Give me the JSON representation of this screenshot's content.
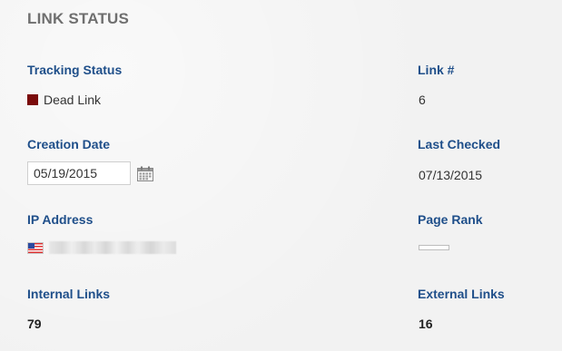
{
  "section": {
    "title": "LINK STATUS"
  },
  "tracking_status": {
    "label": "Tracking Status",
    "value": "Dead Link",
    "color": "#7a0b0b"
  },
  "link_number": {
    "label": "Link #",
    "value": "6"
  },
  "creation_date": {
    "label": "Creation Date",
    "value": "05/19/2015"
  },
  "last_checked": {
    "label": "Last Checked",
    "value": "07/13/2015"
  },
  "ip_address": {
    "label": "IP Address",
    "flag": "us-flag-icon",
    "value_redacted": true
  },
  "page_rank": {
    "label": "Page Rank",
    "value": 0
  },
  "internal_links": {
    "label": "Internal Links",
    "value": "79"
  },
  "external_links": {
    "label": "External Links",
    "value": "16"
  }
}
